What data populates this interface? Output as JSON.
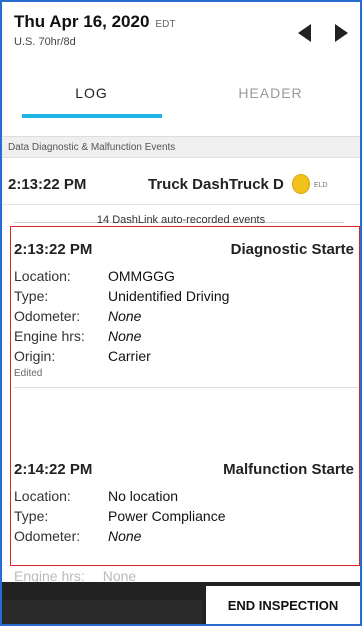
{
  "header": {
    "date": "Thu Apr 16, 2020",
    "timezone": "EDT",
    "rule": "U.S. 70hr/8d",
    "prev_icon": "chevron-left-icon",
    "next_icon": "chevron-right-icon"
  },
  "tabs": [
    {
      "label": "LOG",
      "active": true
    },
    {
      "label": "HEADER",
      "active": false
    }
  ],
  "banner": {
    "label": "Data Diagnostic & Malfunction Events"
  },
  "top_row": {
    "time": "2:13:22 PM",
    "device": "Truck DashTruck D",
    "badge": "ELD"
  },
  "autorecorded": "14 DashLink auto-recorded events",
  "events": [
    {
      "time": "2:13:22 PM",
      "title": "Diagnostic Starte",
      "fields": [
        {
          "key": "Location:",
          "value": "OMMGGG",
          "italic": false
        },
        {
          "key": "Type:",
          "value": "Unidentified Driving",
          "italic": false
        },
        {
          "key": "Odometer:",
          "value": "None",
          "italic": true
        },
        {
          "key": "Engine hrs:",
          "value": "None",
          "italic": true
        },
        {
          "key": "Origin:",
          "value": "Carrier",
          "italic": false
        }
      ],
      "note": "Edited"
    },
    {
      "time": "2:14:22 PM",
      "title": "Malfunction Starte",
      "fields": [
        {
          "key": "Location:",
          "value": "No location",
          "italic": false
        },
        {
          "key": "Type:",
          "value": "Power Compliance",
          "italic": false
        },
        {
          "key": "Odometer:",
          "value": "None",
          "italic": true
        }
      ]
    }
  ],
  "partial_row": {
    "key": "Engine hrs:",
    "value": "None"
  },
  "footer": {
    "end_button": "END INSPECTION"
  },
  "colors": {
    "accent": "#1fb4e3",
    "highlight_box": "#e02222",
    "frame": "#2a6bd1"
  }
}
